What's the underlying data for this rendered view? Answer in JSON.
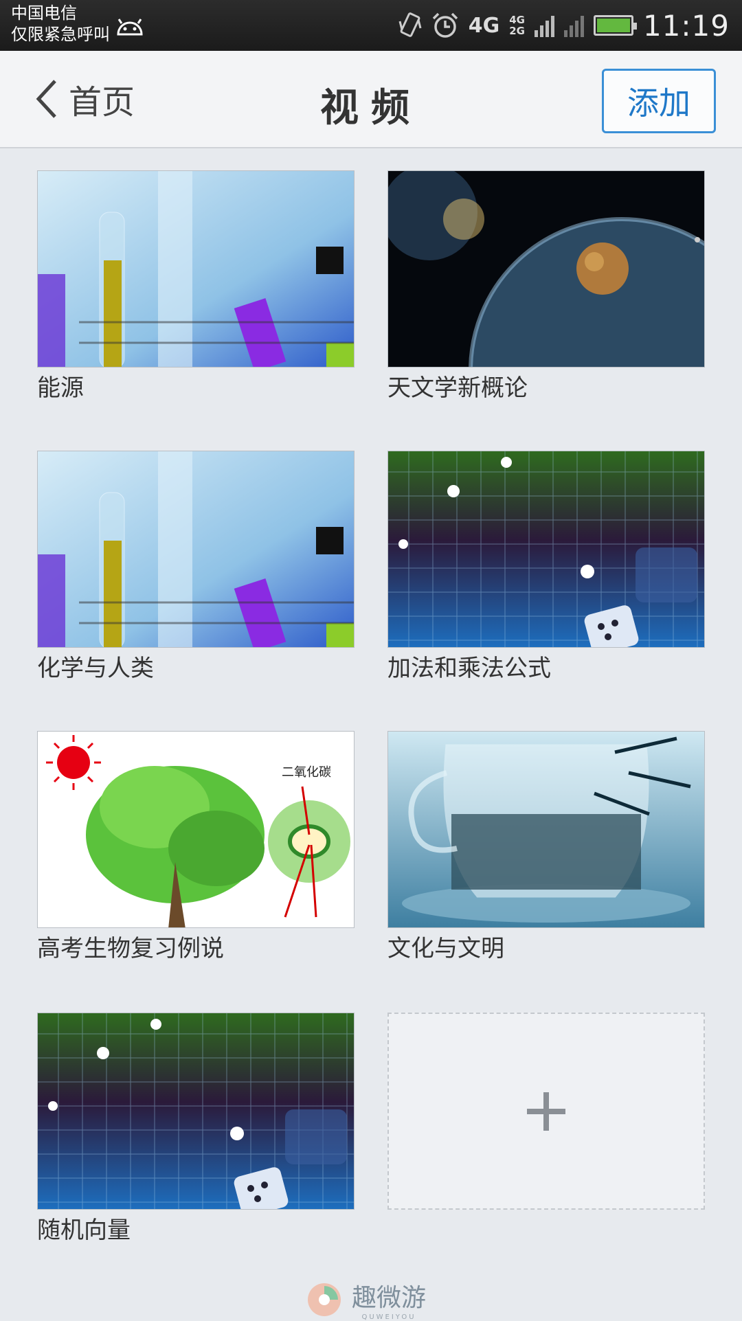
{
  "status_bar": {
    "carrier_line1": "中国电信",
    "carrier_line2": "仅限紧急呼叫",
    "network": "4G",
    "network_small_top": "4G",
    "network_small_bottom": "2G",
    "time": "11:19"
  },
  "header": {
    "back_label": "首页",
    "title": "视频",
    "add_label": "添加"
  },
  "videos": [
    {
      "title": "能源",
      "thumbnail": "lab-test-tubes"
    },
    {
      "title": "天文学新概论",
      "thumbnail": "space-planet"
    },
    {
      "title": "化学与人类",
      "thumbnail": "lab-test-tubes"
    },
    {
      "title": "加法和乘法公式",
      "thumbnail": "numbers-grid-dice"
    },
    {
      "title": "高考生物复习例说",
      "thumbnail": "tree-photosynthesis"
    },
    {
      "title": "文化与文明",
      "thumbnail": "glass-teacup"
    },
    {
      "title": "随机向量",
      "thumbnail": "numbers-grid-dice"
    }
  ],
  "tree_diagram_label": "二氧化碳",
  "watermark": {
    "text": "趣微游",
    "subtext": "QUWEIYOU"
  },
  "colors": {
    "accent": "#1f78c8",
    "background": "#e7eaee"
  }
}
